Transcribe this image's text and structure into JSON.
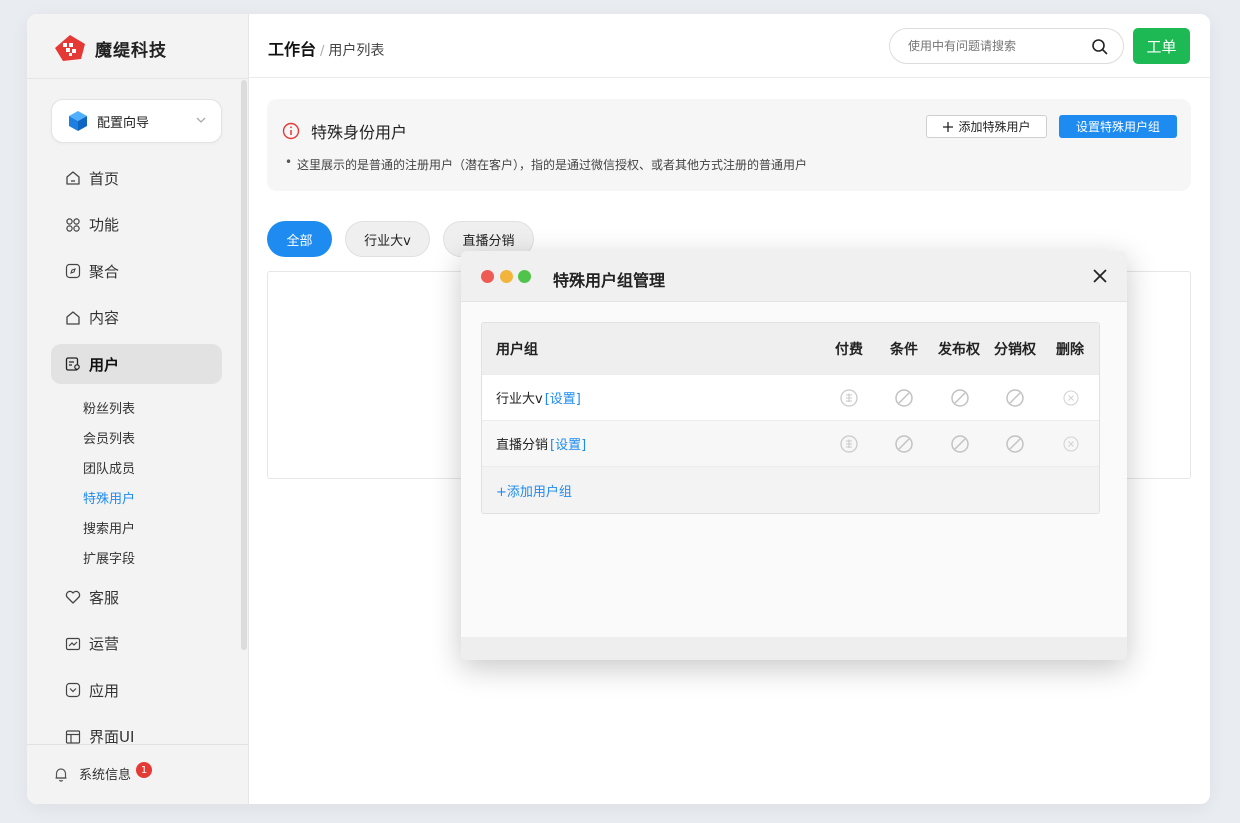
{
  "brand": {
    "name": "魔缇科技",
    "accent": "#e53935"
  },
  "sidebar": {
    "guide_label": "配置向导",
    "items": [
      {
        "label": "首页",
        "icon": "home-icon"
      },
      {
        "label": "功能",
        "icon": "grid-icon"
      },
      {
        "label": "聚合",
        "icon": "compass-icon"
      },
      {
        "label": "内容",
        "icon": "content-icon"
      },
      {
        "label": "用户",
        "icon": "user-card-icon",
        "active": true
      }
    ],
    "sub_items": [
      "粉丝列表",
      "会员列表",
      "团队成员",
      "特殊用户",
      "搜索用户",
      "扩展字段"
    ],
    "active_sub": "特殊用户",
    "items2": [
      {
        "label": "客服",
        "icon": "heart-icon"
      },
      {
        "label": "运营",
        "icon": "chart-icon"
      },
      {
        "label": "应用",
        "icon": "app-icon"
      },
      {
        "label": "界面UI",
        "icon": "layout-icon"
      }
    ],
    "system_info": "系统信息",
    "system_badge": "1"
  },
  "header": {
    "breadcrumb_root": "工作台",
    "breadcrumb_sep": "/",
    "breadcrumb_current": "用户列表",
    "search_placeholder": "使用中有问题请搜索",
    "ticket_label": "工单"
  },
  "notice": {
    "title": "特殊身份用户",
    "desc": "这里展示的是普通的注册用户（潜在客户），指的是通过微信授权、或者其他方式注册的普通用户",
    "add_label": "添加特殊用户",
    "set_label": "设置特殊用户组"
  },
  "filters": [
    "全部",
    "行业大v",
    "直播分销"
  ],
  "modal": {
    "title": "特殊用户组管理",
    "columns": [
      "用户组",
      "付费",
      "条件",
      "发布权",
      "分销权",
      "删除"
    ],
    "rows": [
      {
        "name": "行业大v",
        "setting": "[设置]"
      },
      {
        "name": "直播分销",
        "setting": "[设置]"
      }
    ],
    "add_group": "+添加用户组"
  }
}
